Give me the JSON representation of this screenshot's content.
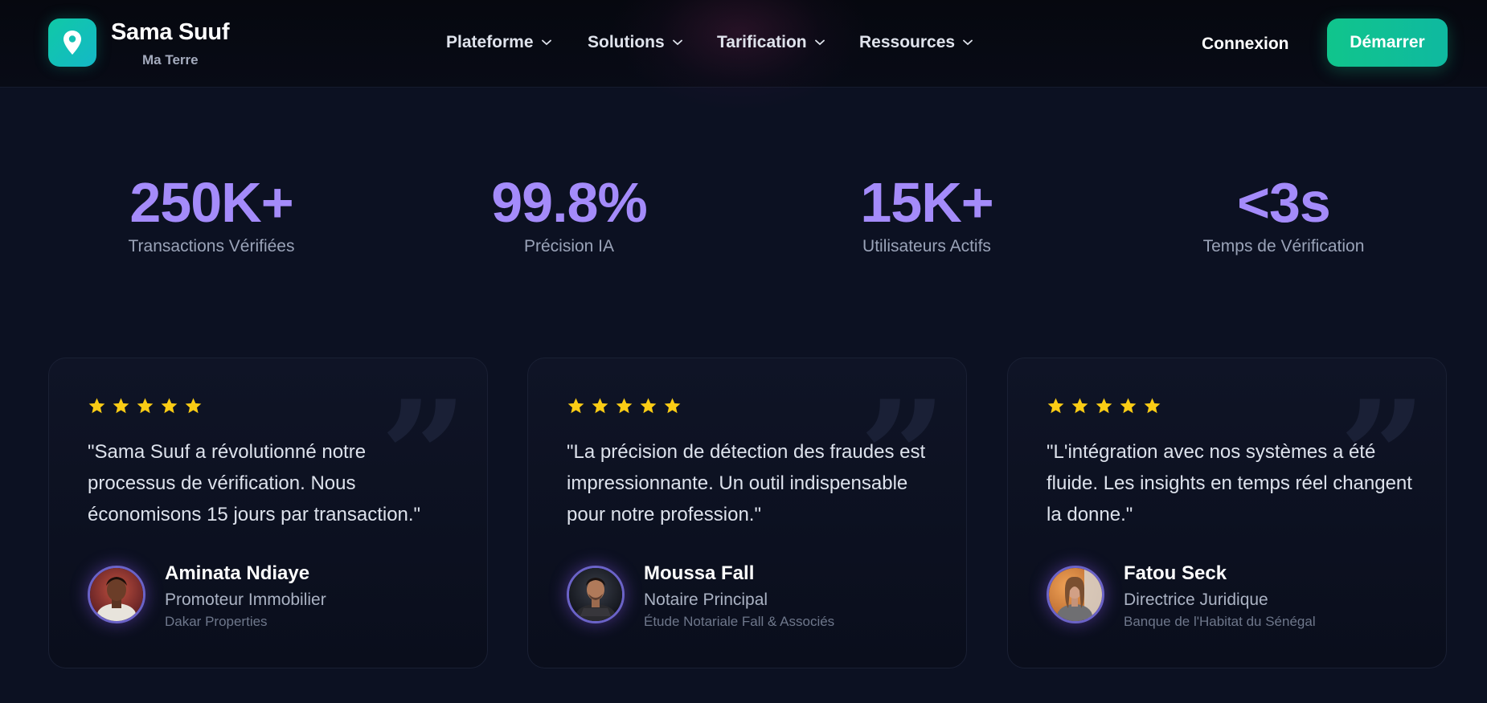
{
  "brand": {
    "name": "Sama Suuf",
    "tagline": "Ma Terre",
    "logo_icon": "map-pin-icon",
    "accent": "#10c9a6"
  },
  "nav": {
    "items": [
      {
        "label": "Plateforme",
        "icon": "chevron-down-icon"
      },
      {
        "label": "Solutions",
        "icon": "chevron-down-icon"
      },
      {
        "label": "Tarification",
        "icon": "chevron-down-icon"
      },
      {
        "label": "Ressources",
        "icon": "chevron-down-icon"
      }
    ],
    "login_label": "Connexion",
    "cta_label": "Démarrer",
    "cta_color": "#10c58c"
  },
  "stats": [
    {
      "value": "250K+",
      "label": "Transactions Vérifiées"
    },
    {
      "value": "99.8%",
      "label": "Précision IA"
    },
    {
      "value": "15K+",
      "label": "Utilisateurs Actifs"
    },
    {
      "value": "<3s",
      "label": "Temps de Vérification"
    }
  ],
  "stat_color": "#a48bfa",
  "testimonials": [
    {
      "rating": 5,
      "quote": "\"Sama Suuf a révolutionné notre processus de vérification. Nous économisons 15 jours par transaction.\"",
      "name": "Aminata Ndiaye",
      "role": "Promoteur Immobilier",
      "company": "Dakar Properties"
    },
    {
      "rating": 5,
      "quote": "\"La précision de détection des fraudes est impressionnante. Un outil indispensable pour notre profession.\"",
      "name": "Moussa Fall",
      "role": "Notaire Principal",
      "company": "Étude Notariale Fall & Associés"
    },
    {
      "rating": 5,
      "quote": "\"L'intégration avec nos systèmes a été fluide. Les insights en temps réel changent la donne.\"",
      "name": "Fatou Seck",
      "role": "Directrice Juridique",
      "company": "Banque de l'Habitat du Sénégal"
    }
  ],
  "star_color": "#facc15"
}
